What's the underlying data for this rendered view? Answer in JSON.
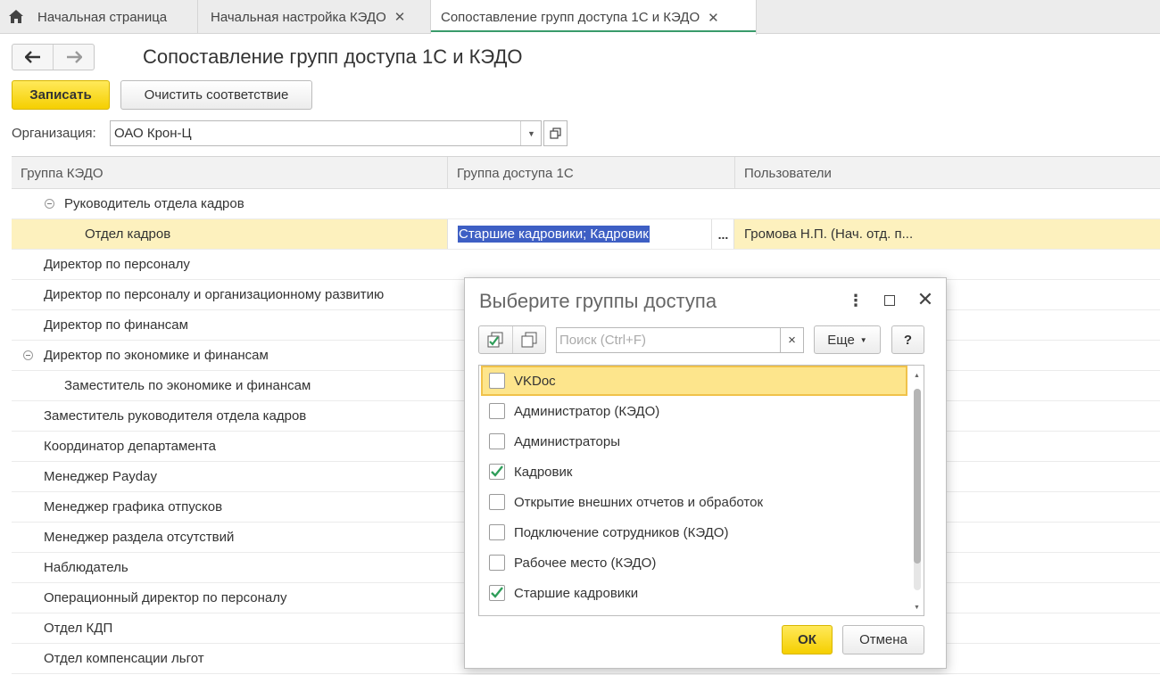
{
  "tabs": [
    {
      "label": "Начальная страница"
    },
    {
      "label": "Начальная настройка КЭДО",
      "close": "✕"
    },
    {
      "label": "Сопоставление групп доступа 1С и КЭДО",
      "close": "✕"
    }
  ],
  "nav": {
    "back": "🡐",
    "forward": "🡒"
  },
  "page": {
    "title": "Сопоставление групп доступа 1С и КЭДО"
  },
  "toolbar": {
    "save_label": "Записать",
    "clear_label": "Очистить соответствие"
  },
  "organization": {
    "label": "Организация:",
    "value": "ОАО Крон-Ц"
  },
  "table": {
    "columns": [
      "Группа КЭДО",
      "Группа доступа 1С",
      "Пользователи"
    ],
    "rows": [
      {
        "name": "Руководитель отдела кадров",
        "group": "",
        "users": ""
      },
      {
        "name": "Отдел кадров",
        "group": "Старшие кадровики; Кадровик",
        "users": "Громова Н.П. (Нач. отд. п..."
      },
      {
        "name": "Директор по персоналу"
      },
      {
        "name": "Директор по персоналу и организационному развитию"
      },
      {
        "name": "Директор по финансам"
      },
      {
        "name": "Директор по экономике и финансам"
      },
      {
        "name": "Заместитель по экономике и финансам"
      },
      {
        "name": "Заместитель руководителя отдела кадров"
      },
      {
        "name": "Координатор департамента"
      },
      {
        "name": "Менеджер Payday"
      },
      {
        "name": "Менеджер графика отпусков"
      },
      {
        "name": "Менеджер раздела отсутствий"
      },
      {
        "name": "Наблюдатель"
      },
      {
        "name": "Операционный директор по персоналу"
      },
      {
        "name": "Отдел КДП"
      },
      {
        "name": "Отдел компенсации льгот"
      }
    ],
    "dots_label": "..."
  },
  "dialog": {
    "title": "Выберите группы доступа",
    "menu_glyph": "⋮",
    "close_glyph": "✕",
    "search_placeholder": "Поиск (Ctrl+F)",
    "search_clear": "×",
    "more_label": "Еще",
    "more_caret": "▼",
    "help_label": "?",
    "items": [
      {
        "label": "VKDoc",
        "checked": false
      },
      {
        "label": "Администратор (КЭДО)",
        "checked": false
      },
      {
        "label": "Администраторы",
        "checked": false
      },
      {
        "label": "Кадровик",
        "checked": true
      },
      {
        "label": "Открытие внешних отчетов и обработок",
        "checked": false
      },
      {
        "label": "Подключение сотрудников (КЭДО)",
        "checked": false
      },
      {
        "label": "Рабочее место (КЭДО)",
        "checked": false
      },
      {
        "label": "Старшие кадровики",
        "checked": true
      }
    ],
    "ok_label": "ОК",
    "cancel_label": "Отмена",
    "scroll_up": "▲",
    "scroll_down": "▼"
  },
  "colors": {
    "accent_green": "#3a9b6b",
    "check_green": "#2f9e5a",
    "primary_yellow": "#f5cf00",
    "selection_blue": "#3e5fc4",
    "row_highlight": "#fdf1be"
  }
}
